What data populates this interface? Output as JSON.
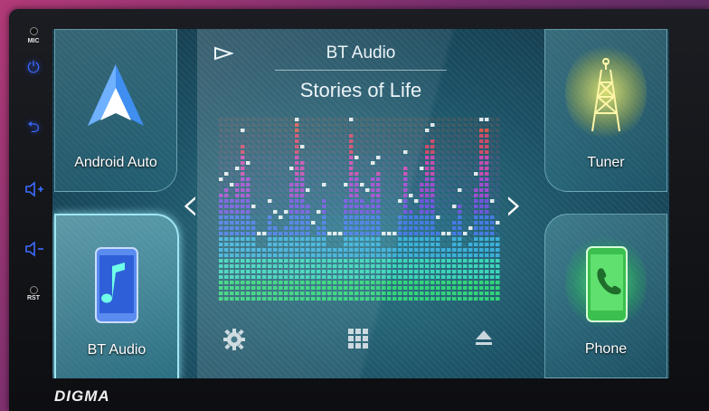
{
  "side_panel": {
    "mic_label": "MIC",
    "rst_label": "RST",
    "buttons": [
      "power-icon",
      "back-icon",
      "volume-up-icon",
      "volume-down-icon"
    ]
  },
  "tiles": {
    "android_auto": "Android Auto",
    "bt_audio": "BT Audio",
    "tuner": "Tuner",
    "phone": "Phone"
  },
  "now_playing": {
    "source": "BT Audio",
    "track": "Stories of Life"
  },
  "brand": "DIGMA",
  "colors": {
    "accent_blue": "#3d6bff",
    "tile_border": "#9fe6f2",
    "tuner_glow": "#e8e85a",
    "phone_glow": "#4cff6a"
  }
}
